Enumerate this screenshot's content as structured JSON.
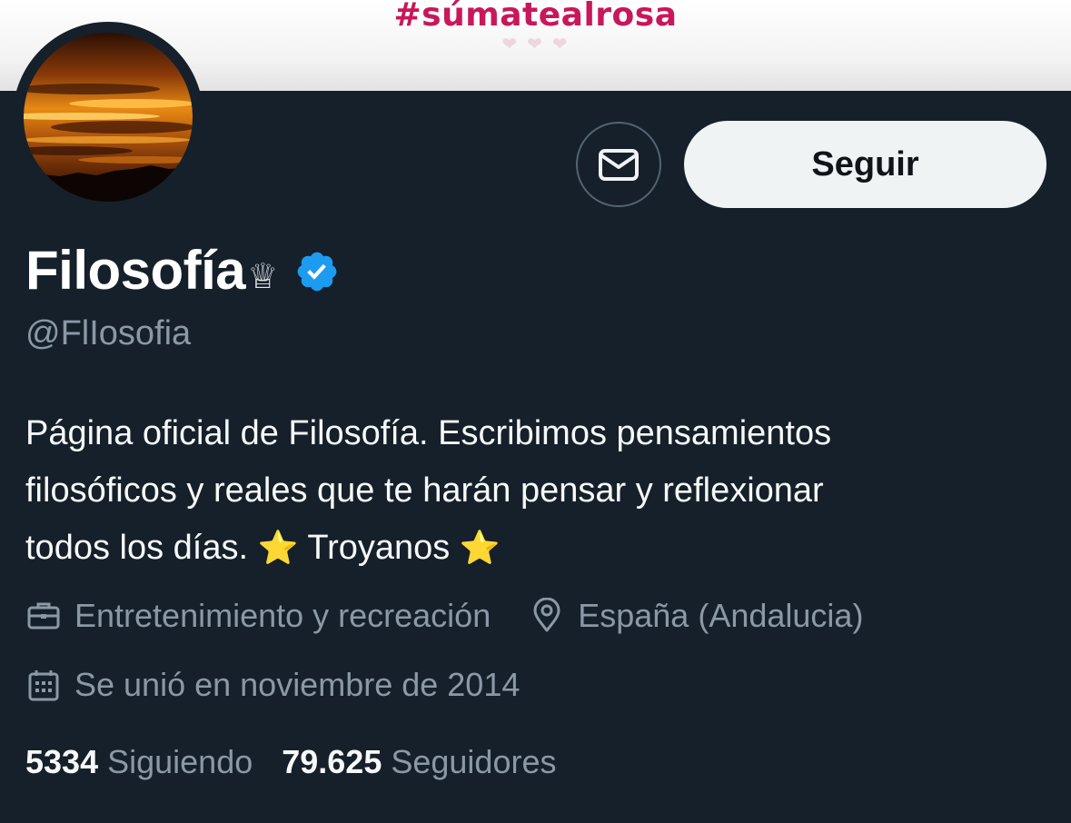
{
  "banner": {
    "text": "#súmatealrosa"
  },
  "profile": {
    "display_name": "Filosofía",
    "name_emoji": "♕",
    "handle": "@FlIosofia",
    "bio_lines": [
      "Página oficial de Filosofía. Escribimos pensamientos",
      "filosóficos y reales que te harán pensar y reflexionar"
    ],
    "bio_last_text": "todos los días.",
    "bio_star": "⭐",
    "bio_tail": "Troyanos",
    "category": "Entretenimiento y recreación",
    "location": "España (Andalucia)",
    "joined": "Se unió en noviembre de 2014"
  },
  "actions": {
    "follow_label": "Seguir"
  },
  "stats": {
    "following_count": "5334",
    "following_label": "Siguiendo",
    "followers_count": "79.625",
    "followers_label": "Seguidores"
  },
  "icons": {
    "message": "envelope-icon",
    "verified": "verified-badge-icon",
    "category": "briefcase-icon",
    "location": "location-pin-icon",
    "joined": "calendar-icon"
  },
  "colors": {
    "background": "#15202b",
    "follow_button": "#eff3f4",
    "verified": "#1d9bf0",
    "secondary_text": "#8b98a5",
    "banner_accent": "#c8175a"
  }
}
